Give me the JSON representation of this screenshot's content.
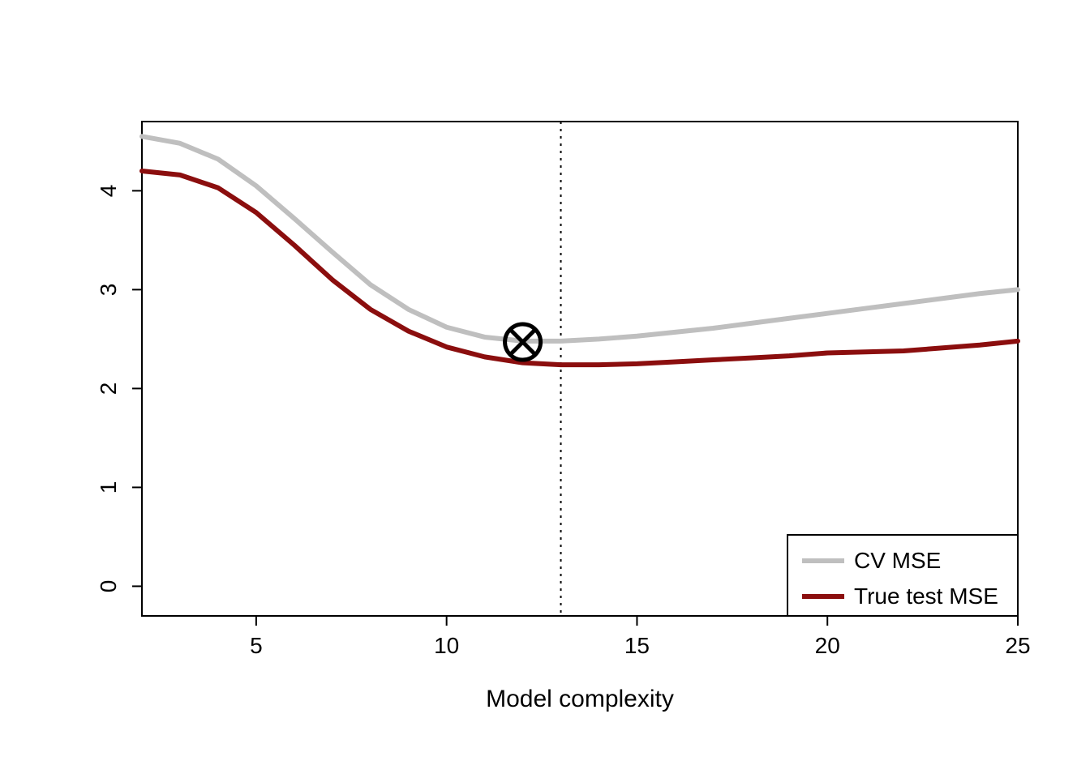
{
  "chart_data": {
    "type": "line",
    "xlabel": "Model complexity",
    "ylabel": "",
    "xlim": [
      2,
      25
    ],
    "ylim": [
      -0.3,
      4.7
    ],
    "x_ticks": [
      5,
      10,
      15,
      20,
      25
    ],
    "y_ticks": [
      0,
      1,
      2,
      3,
      4
    ],
    "vline_x": 13,
    "marker": {
      "x": 12,
      "y": 2.47
    },
    "legend": {
      "position": "bottomright",
      "items": [
        {
          "label": "CV MSE",
          "color": "#bfbfbf"
        },
        {
          "label": "True test MSE",
          "color": "#8b0e0e"
        }
      ]
    },
    "series": [
      {
        "name": "CV MSE",
        "color": "#bfbfbf",
        "x": [
          2,
          3,
          4,
          5,
          6,
          7,
          8,
          9,
          10,
          11,
          12,
          13,
          14,
          15,
          16,
          17,
          18,
          19,
          20,
          21,
          22,
          23,
          24,
          25
        ],
        "values": [
          4.55,
          4.48,
          4.32,
          4.05,
          3.72,
          3.38,
          3.05,
          2.8,
          2.62,
          2.52,
          2.48,
          2.48,
          2.5,
          2.53,
          2.57,
          2.61,
          2.66,
          2.71,
          2.76,
          2.81,
          2.86,
          2.91,
          2.96,
          3.0
        ]
      },
      {
        "name": "True test MSE",
        "color": "#8b0e0e",
        "x": [
          2,
          3,
          4,
          5,
          6,
          7,
          8,
          9,
          10,
          11,
          12,
          13,
          14,
          15,
          16,
          17,
          18,
          19,
          20,
          21,
          22,
          23,
          24,
          25
        ],
        "values": [
          4.2,
          4.16,
          4.03,
          3.78,
          3.45,
          3.1,
          2.8,
          2.58,
          2.42,
          2.32,
          2.26,
          2.24,
          2.24,
          2.25,
          2.27,
          2.29,
          2.31,
          2.33,
          2.36,
          2.37,
          2.38,
          2.41,
          2.44,
          2.48
        ]
      }
    ]
  }
}
